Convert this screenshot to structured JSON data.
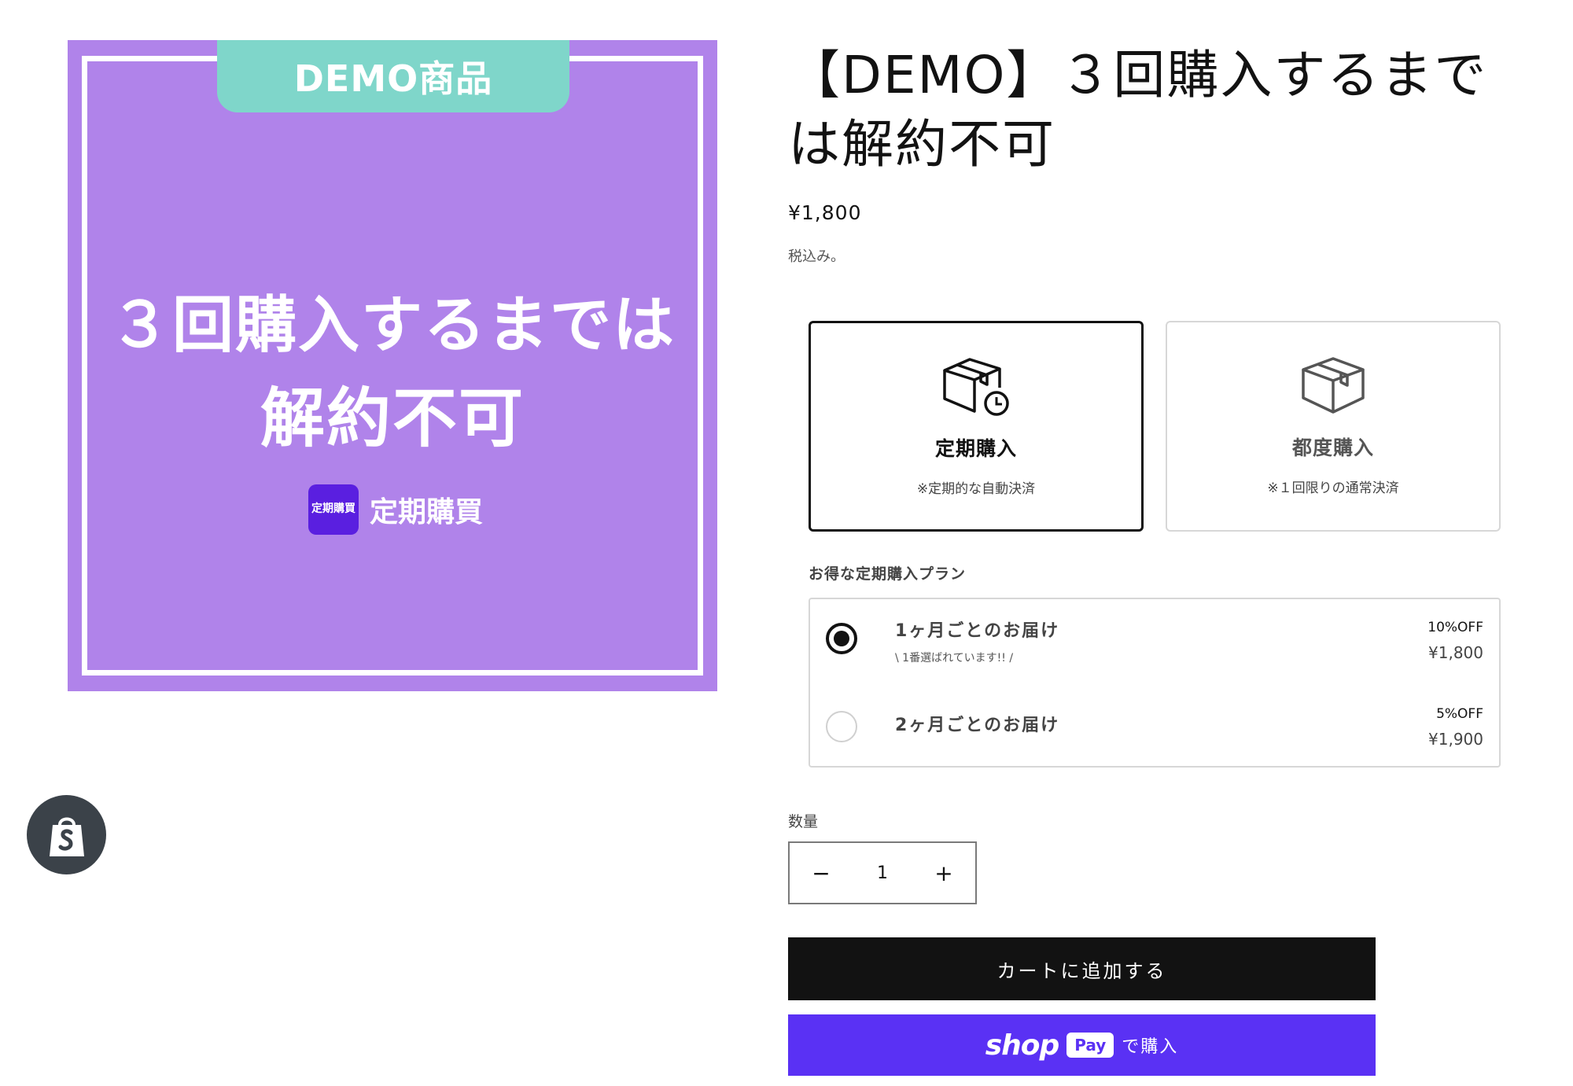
{
  "product_image": {
    "demo_badge": "DEMO商品",
    "headline_line1": "３回購入するまでは",
    "headline_line2": "解約不可",
    "logo_box_text": "定期購買",
    "logo_text": "定期購買",
    "bg_color": "#b083ea",
    "badge_color": "#7fd6ca"
  },
  "shopify_badge": {
    "icon": "shopify-bag-icon"
  },
  "product": {
    "title": "【DEMO】３回購入するまでは解約不可",
    "price": "¥1,800",
    "tax_note": "税込み。"
  },
  "purchase_options": [
    {
      "label": "定期購入",
      "note": "※定期的な自動決済",
      "icon": "box-clock-icon",
      "selected": true
    },
    {
      "label": "都度購入",
      "note": "※１回限りの通常決済",
      "icon": "box-icon",
      "selected": false
    }
  ],
  "plan_heading": "お得な定期購入プラン",
  "plans": [
    {
      "name": "1ヶ月ごとのお届け",
      "sub": "\\ 1番選ばれています!! /",
      "discount": "10%OFF",
      "price": "¥1,800",
      "selected": true
    },
    {
      "name": "2ヶ月ごとのお届け",
      "sub": "",
      "discount": "5%OFF",
      "price": "¥1,900",
      "selected": false
    }
  ],
  "quantity": {
    "label": "数量",
    "value": "1",
    "minus": "−",
    "plus": "+"
  },
  "buttons": {
    "add_to_cart": "カートに追加する",
    "shop_word": "shop",
    "pay_word": "Pay",
    "shop_pay_suffix": "で購入"
  },
  "colors": {
    "accent": "#121212",
    "shop_pay": "#5a31f4"
  }
}
